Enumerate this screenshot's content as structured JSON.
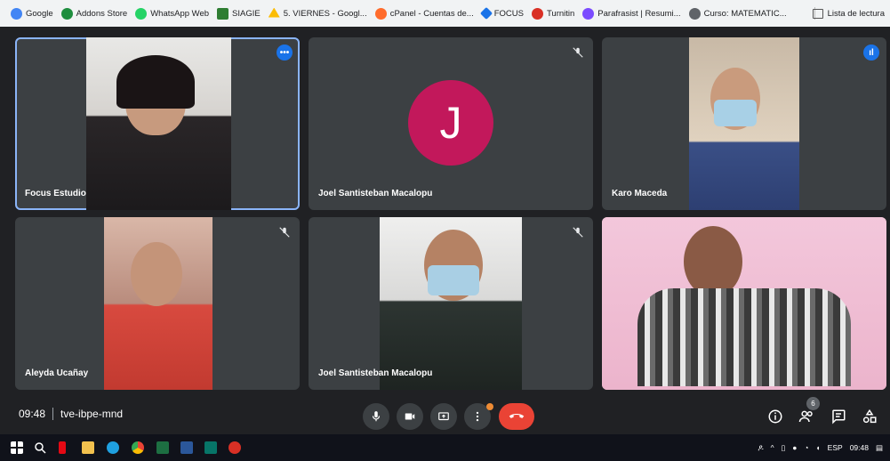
{
  "bookmarks": [
    {
      "label": "Google",
      "icon": "google-icon",
      "color": "#4285f4"
    },
    {
      "label": "Addons Store",
      "icon": "addons-icon",
      "color": "#1e8e3e"
    },
    {
      "label": "WhatsApp Web",
      "icon": "whatsapp-icon",
      "color": "#25d366"
    },
    {
      "label": "SIAGIE",
      "icon": "siagie-icon",
      "color": "#2e7d32"
    },
    {
      "label": "5. VIERNES - Googl...",
      "icon": "drive-icon",
      "color": "#fbbc04"
    },
    {
      "label": "cPanel - Cuentas de...",
      "icon": "cpanel-icon",
      "color": "#ff6c2c"
    },
    {
      "label": "FOCUS",
      "icon": "focus-icon",
      "color": "#1a73e8"
    },
    {
      "label": "Turnitin",
      "icon": "turnitin-icon",
      "color": "#d93025"
    },
    {
      "label": "Parafrasist | Resumi...",
      "icon": "parafrasist-icon",
      "color": "#7b4bff"
    },
    {
      "label": "Curso: MATEMATIC...",
      "icon": "course-icon",
      "color": "#5f6368"
    }
  ],
  "reading_list": "Lista de lectura",
  "participants": [
    {
      "name": "Focus Estudio",
      "type": "video",
      "active": true
    },
    {
      "name": "Joel Santisteban Macalopu",
      "type": "avatar",
      "initial": "J",
      "muted": true
    },
    {
      "name": "Karo Maceda",
      "type": "video",
      "speaking": true
    },
    {
      "name": "Aleyda Ucañay",
      "type": "video",
      "muted": true
    },
    {
      "name": "Joel Santisteban Macalopu",
      "type": "video",
      "muted": true
    },
    {
      "name": "",
      "type": "video"
    }
  ],
  "meeting": {
    "time": "09:48",
    "code": "tve-ibpe-mnd"
  },
  "people_count": "6",
  "tray": {
    "lang": "ESP",
    "time": "09:48"
  },
  "colors": {
    "end_call": "#ea4335",
    "avatar": "#c2185b",
    "accent": "#8ab4f8"
  }
}
